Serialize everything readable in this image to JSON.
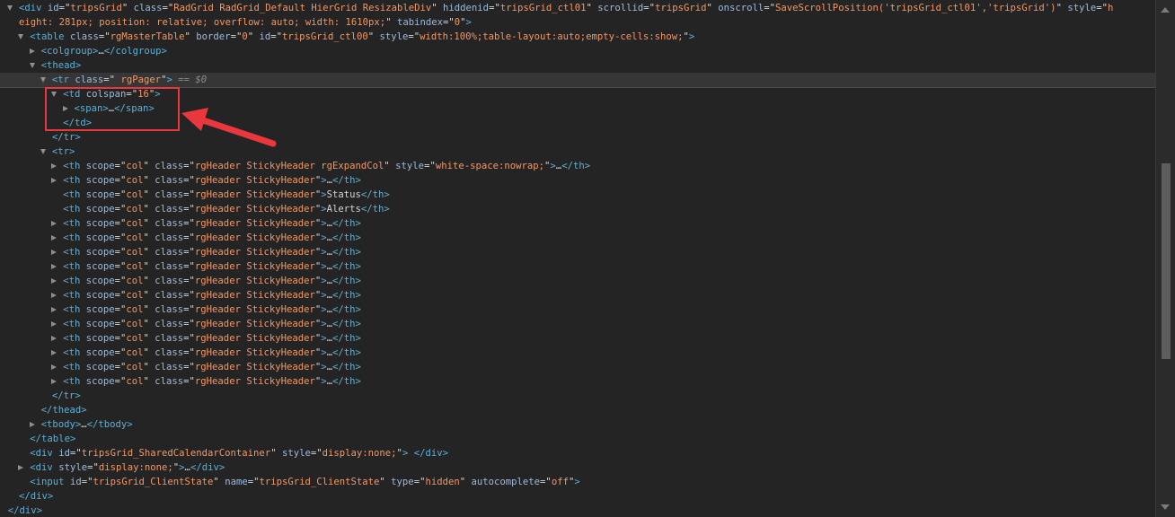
{
  "colors": {
    "background": "#242424",
    "tag": "#5db0d7",
    "attribute_name": "#9bbbdc",
    "attribute_value": "#f29766",
    "text": "#d5d5d5",
    "annotation": "#e8383d"
  },
  "lines": [
    {
      "indent": 0,
      "arrow": "open",
      "tokens": [
        {
          "t": "tag",
          "v": "<div "
        },
        {
          "t": "attr",
          "v": "id"
        },
        {
          "t": "text",
          "v": "=\""
        },
        {
          "t": "val",
          "v": "tripsGrid"
        },
        {
          "t": "text",
          "v": "\" "
        },
        {
          "t": "attr",
          "v": "class"
        },
        {
          "t": "text",
          "v": "=\""
        },
        {
          "t": "val",
          "v": "RadGrid RadGrid_Default HierGrid ResizableDiv"
        },
        {
          "t": "text",
          "v": "\" "
        },
        {
          "t": "attr",
          "v": "hiddenid"
        },
        {
          "t": "text",
          "v": "=\""
        },
        {
          "t": "val",
          "v": "tripsGrid_ctl01"
        },
        {
          "t": "text",
          "v": "\" "
        },
        {
          "t": "attr",
          "v": "scrollid"
        },
        {
          "t": "text",
          "v": "=\""
        },
        {
          "t": "val",
          "v": "tripsGrid"
        },
        {
          "t": "text",
          "v": "\" "
        },
        {
          "t": "attr",
          "v": "onscroll"
        },
        {
          "t": "text",
          "v": "=\""
        },
        {
          "t": "val",
          "v": "SaveScrollPosition('tripsGrid_ctl01','tripsGrid')"
        },
        {
          "t": "text",
          "v": "\" "
        },
        {
          "t": "attr",
          "v": "style"
        },
        {
          "t": "text",
          "v": "=\""
        },
        {
          "t": "val",
          "v": "h"
        }
      ]
    },
    {
      "indent": 0,
      "arrow": "none",
      "tokens": [
        {
          "t": "val",
          "v": "eight: 281px; position: relative; overflow: auto; width: 1610px;"
        },
        {
          "t": "text",
          "v": "\" "
        },
        {
          "t": "attr",
          "v": "tabindex"
        },
        {
          "t": "text",
          "v": "=\""
        },
        {
          "t": "val",
          "v": "0"
        },
        {
          "t": "text",
          "v": "\""
        },
        {
          "t": "tag",
          "v": ">"
        }
      ]
    },
    {
      "indent": 1,
      "arrow": "open",
      "tokens": [
        {
          "t": "tag",
          "v": "<table "
        },
        {
          "t": "attr",
          "v": "class"
        },
        {
          "t": "text",
          "v": "=\""
        },
        {
          "t": "val",
          "v": "rgMasterTable"
        },
        {
          "t": "text",
          "v": "\" "
        },
        {
          "t": "attr",
          "v": "border"
        },
        {
          "t": "text",
          "v": "=\""
        },
        {
          "t": "val",
          "v": "0"
        },
        {
          "t": "text",
          "v": "\" "
        },
        {
          "t": "attr",
          "v": "id"
        },
        {
          "t": "text",
          "v": "=\""
        },
        {
          "t": "val",
          "v": "tripsGrid_ctl00"
        },
        {
          "t": "text",
          "v": "\" "
        },
        {
          "t": "attr",
          "v": "style"
        },
        {
          "t": "text",
          "v": "=\""
        },
        {
          "t": "val",
          "v": "width:100%;table-layout:auto;empty-cells:show;"
        },
        {
          "t": "text",
          "v": "\""
        },
        {
          "t": "tag",
          "v": ">"
        }
      ]
    },
    {
      "indent": 2,
      "arrow": "closed",
      "tokens": [
        {
          "t": "tag",
          "v": "<colgroup>"
        },
        {
          "t": "text",
          "v": "…"
        },
        {
          "t": "tag",
          "v": "</colgroup>"
        }
      ]
    },
    {
      "indent": 2,
      "arrow": "open",
      "tokens": [
        {
          "t": "tag",
          "v": "<thead>"
        }
      ]
    },
    {
      "indent": 3,
      "arrow": "open",
      "selected": true,
      "tokens": [
        {
          "t": "tag",
          "v": "<tr "
        },
        {
          "t": "attr",
          "v": "class"
        },
        {
          "t": "text",
          "v": "=\""
        },
        {
          "t": "val",
          "v": " rgPager"
        },
        {
          "t": "text",
          "v": "\""
        },
        {
          "t": "tag",
          "v": ">"
        },
        {
          "t": "dim",
          "v": " == $0"
        }
      ]
    },
    {
      "indent": 4,
      "arrow": "open",
      "tokens": [
        {
          "t": "tag",
          "v": "<td "
        },
        {
          "t": "attr",
          "v": "colspan"
        },
        {
          "t": "text",
          "v": "=\""
        },
        {
          "t": "val",
          "v": "16"
        },
        {
          "t": "text",
          "v": "\""
        },
        {
          "t": "tag",
          "v": ">"
        }
      ]
    },
    {
      "indent": 5,
      "arrow": "closed",
      "tokens": [
        {
          "t": "tag",
          "v": "<span>"
        },
        {
          "t": "text",
          "v": "…"
        },
        {
          "t": "tag",
          "v": "</span>"
        }
      ]
    },
    {
      "indent": 4,
      "arrow": "none",
      "tokens": [
        {
          "t": "tag",
          "v": "</td>"
        }
      ]
    },
    {
      "indent": 3,
      "arrow": "none",
      "tokens": [
        {
          "t": "tag",
          "v": "</tr>"
        }
      ]
    },
    {
      "indent": 3,
      "arrow": "open",
      "tokens": [
        {
          "t": "tag",
          "v": "<tr>"
        }
      ]
    },
    {
      "indent": 4,
      "arrow": "closed",
      "tokens": [
        {
          "t": "tag",
          "v": "<th "
        },
        {
          "t": "attr",
          "v": "scope"
        },
        {
          "t": "text",
          "v": "=\""
        },
        {
          "t": "val",
          "v": "col"
        },
        {
          "t": "text",
          "v": "\" "
        },
        {
          "t": "attr",
          "v": "class"
        },
        {
          "t": "text",
          "v": "=\""
        },
        {
          "t": "val",
          "v": "rgHeader StickyHeader rgExpandCol"
        },
        {
          "t": "text",
          "v": "\" "
        },
        {
          "t": "attr",
          "v": "style"
        },
        {
          "t": "text",
          "v": "=\""
        },
        {
          "t": "val",
          "v": "white-space:nowrap;"
        },
        {
          "t": "text",
          "v": "\""
        },
        {
          "t": "tag",
          "v": ">"
        },
        {
          "t": "text",
          "v": "…"
        },
        {
          "t": "tag",
          "v": "</th>"
        }
      ]
    },
    {
      "indent": 4,
      "arrow": "closed",
      "tokens": [
        {
          "t": "tag",
          "v": "<th "
        },
        {
          "t": "attr",
          "v": "scope"
        },
        {
          "t": "text",
          "v": "=\""
        },
        {
          "t": "val",
          "v": "col"
        },
        {
          "t": "text",
          "v": "\" "
        },
        {
          "t": "attr",
          "v": "class"
        },
        {
          "t": "text",
          "v": "=\""
        },
        {
          "t": "val",
          "v": "rgHeader StickyHeader"
        },
        {
          "t": "text",
          "v": "\""
        },
        {
          "t": "tag",
          "v": ">"
        },
        {
          "t": "text",
          "v": "…"
        },
        {
          "t": "tag",
          "v": "</th>"
        }
      ]
    },
    {
      "indent": 4,
      "arrow": "none",
      "tokens": [
        {
          "t": "tag",
          "v": "<th "
        },
        {
          "t": "attr",
          "v": "scope"
        },
        {
          "t": "text",
          "v": "=\""
        },
        {
          "t": "val",
          "v": "col"
        },
        {
          "t": "text",
          "v": "\" "
        },
        {
          "t": "attr",
          "v": "class"
        },
        {
          "t": "text",
          "v": "=\""
        },
        {
          "t": "val",
          "v": "rgHeader StickyHeader"
        },
        {
          "t": "text",
          "v": "\""
        },
        {
          "t": "tag",
          "v": ">"
        },
        {
          "t": "text",
          "v": "Status"
        },
        {
          "t": "tag",
          "v": "</th>"
        }
      ]
    },
    {
      "indent": 4,
      "arrow": "none",
      "tokens": [
        {
          "t": "tag",
          "v": "<th "
        },
        {
          "t": "attr",
          "v": "scope"
        },
        {
          "t": "text",
          "v": "=\""
        },
        {
          "t": "val",
          "v": "col"
        },
        {
          "t": "text",
          "v": "\" "
        },
        {
          "t": "attr",
          "v": "class"
        },
        {
          "t": "text",
          "v": "=\""
        },
        {
          "t": "val",
          "v": "rgHeader StickyHeader"
        },
        {
          "t": "text",
          "v": "\""
        },
        {
          "t": "tag",
          "v": ">"
        },
        {
          "t": "text",
          "v": "Alerts"
        },
        {
          "t": "tag",
          "v": "</th>"
        }
      ]
    },
    {
      "indent": 4,
      "arrow": "closed",
      "repeat_th": true
    },
    {
      "indent": 4,
      "arrow": "closed",
      "repeat_th": true
    },
    {
      "indent": 4,
      "arrow": "closed",
      "repeat_th": true
    },
    {
      "indent": 4,
      "arrow": "closed",
      "repeat_th": true
    },
    {
      "indent": 4,
      "arrow": "closed",
      "repeat_th": true
    },
    {
      "indent": 4,
      "arrow": "closed",
      "repeat_th": true
    },
    {
      "indent": 4,
      "arrow": "closed",
      "repeat_th": true
    },
    {
      "indent": 4,
      "arrow": "closed",
      "repeat_th": true
    },
    {
      "indent": 4,
      "arrow": "closed",
      "repeat_th": true
    },
    {
      "indent": 4,
      "arrow": "closed",
      "repeat_th": true
    },
    {
      "indent": 4,
      "arrow": "closed",
      "repeat_th": true
    },
    {
      "indent": 4,
      "arrow": "closed",
      "repeat_th": true
    },
    {
      "indent": 3,
      "arrow": "none",
      "tokens": [
        {
          "t": "tag",
          "v": "</tr>"
        }
      ]
    },
    {
      "indent": 2,
      "arrow": "none",
      "tokens": [
        {
          "t": "tag",
          "v": "</thead>"
        }
      ]
    },
    {
      "indent": 2,
      "arrow": "closed",
      "tokens": [
        {
          "t": "tag",
          "v": "<tbody>"
        },
        {
          "t": "text",
          "v": "…"
        },
        {
          "t": "tag",
          "v": "</tbody>"
        }
      ]
    },
    {
      "indent": 1,
      "arrow": "none",
      "tokens": [
        {
          "t": "tag",
          "v": "</table>"
        }
      ]
    },
    {
      "indent": 1,
      "arrow": "none",
      "tokens": [
        {
          "t": "tag",
          "v": "<div "
        },
        {
          "t": "attr",
          "v": "id"
        },
        {
          "t": "text",
          "v": "=\""
        },
        {
          "t": "val",
          "v": "tripsGrid_SharedCalendarContainer"
        },
        {
          "t": "text",
          "v": "\" "
        },
        {
          "t": "attr",
          "v": "style"
        },
        {
          "t": "text",
          "v": "=\""
        },
        {
          "t": "val",
          "v": "display:none;"
        },
        {
          "t": "text",
          "v": "\""
        },
        {
          "t": "tag",
          "v": ">"
        },
        {
          "t": "text",
          "v": " "
        },
        {
          "t": "tag",
          "v": "</div>"
        }
      ]
    },
    {
      "indent": 1,
      "arrow": "closed",
      "tokens": [
        {
          "t": "tag",
          "v": "<div "
        },
        {
          "t": "attr",
          "v": "style"
        },
        {
          "t": "text",
          "v": "=\""
        },
        {
          "t": "val",
          "v": "display:none;"
        },
        {
          "t": "text",
          "v": "\""
        },
        {
          "t": "tag",
          "v": ">"
        },
        {
          "t": "text",
          "v": "…"
        },
        {
          "t": "tag",
          "v": "</div>"
        }
      ]
    },
    {
      "indent": 1,
      "arrow": "none",
      "tokens": [
        {
          "t": "tag",
          "v": "<input "
        },
        {
          "t": "attr",
          "v": "id"
        },
        {
          "t": "text",
          "v": "=\""
        },
        {
          "t": "val",
          "v": "tripsGrid_ClientState"
        },
        {
          "t": "text",
          "v": "\" "
        },
        {
          "t": "attr",
          "v": "name"
        },
        {
          "t": "text",
          "v": "=\""
        },
        {
          "t": "val",
          "v": "tripsGrid_ClientState"
        },
        {
          "t": "text",
          "v": "\" "
        },
        {
          "t": "attr",
          "v": "type"
        },
        {
          "t": "text",
          "v": "=\""
        },
        {
          "t": "val",
          "v": "hidden"
        },
        {
          "t": "text",
          "v": "\" "
        },
        {
          "t": "attr",
          "v": "autocomplete"
        },
        {
          "t": "text",
          "v": "=\""
        },
        {
          "t": "val",
          "v": "off"
        },
        {
          "t": "text",
          "v": "\""
        },
        {
          "t": "tag",
          "v": ">"
        }
      ]
    },
    {
      "indent": 0,
      "arrow": "none",
      "tokens": [
        {
          "t": "tag",
          "v": "</div>"
        }
      ]
    },
    {
      "indent": -1,
      "arrow": "none",
      "tokens": [
        {
          "t": "tag",
          "v": "</div>"
        }
      ]
    }
  ],
  "repeat_th_tokens": [
    {
      "t": "tag",
      "v": "<th "
    },
    {
      "t": "attr",
      "v": "scope"
    },
    {
      "t": "text",
      "v": "=\""
    },
    {
      "t": "val",
      "v": "col"
    },
    {
      "t": "text",
      "v": "\" "
    },
    {
      "t": "attr",
      "v": "class"
    },
    {
      "t": "text",
      "v": "=\""
    },
    {
      "t": "val",
      "v": "rgHeader StickyHeader"
    },
    {
      "t": "text",
      "v": "\""
    },
    {
      "t": "tag",
      "v": ">"
    },
    {
      "t": "text",
      "v": "…"
    },
    {
      "t": "tag",
      "v": "</th>"
    }
  ]
}
